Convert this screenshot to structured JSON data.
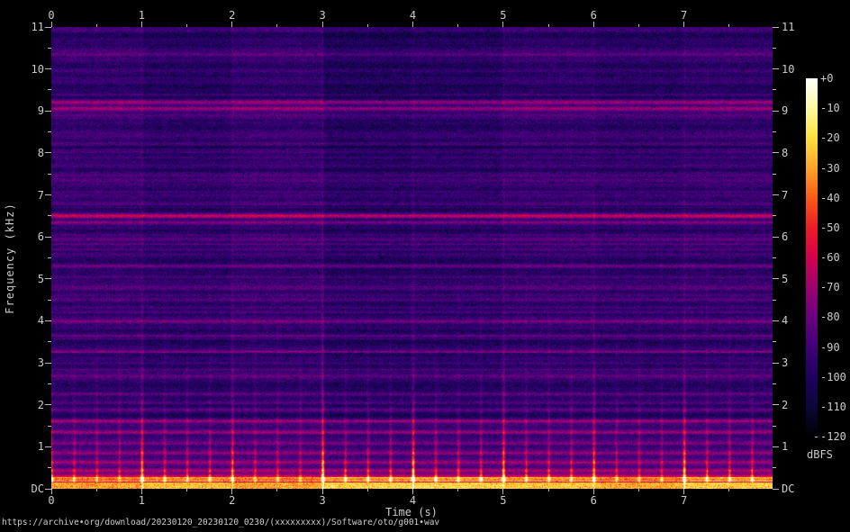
{
  "title": "https://archive•org/download/20230120_20230120_0230/(xxxxxxxxx)/Software/oto/g001•wav",
  "background_color": "#000000",
  "text_color": "#cccccc",
  "axes": {
    "x": {
      "label": "Time (s)",
      "ticks": [
        "0",
        "1",
        "2",
        "3",
        "4",
        "5",
        "6",
        "7"
      ],
      "minor_step_s": 0.5,
      "range_s": [
        0,
        7.98
      ]
    },
    "y": {
      "label": "Frequency (kHz)",
      "ticks": [
        "11",
        "10",
        "9",
        "8",
        "7",
        "6",
        "5",
        "4",
        "3",
        "2",
        "1",
        "DC"
      ],
      "minor_step_khz": 0.5,
      "range_khz": [
        0,
        11
      ]
    }
  },
  "colorbar": {
    "unit": "dBFS",
    "labels": [
      "+0",
      "-10",
      "-20",
      "-30",
      "-40",
      "-50",
      "-60",
      "-70",
      "-80",
      "-90",
      "-100",
      "-110",
      "-120"
    ],
    "stops": [
      "#ffffff",
      "#fffaa0",
      "#ffe03a",
      "#ffa32a",
      "#fb5a18",
      "#ee1c24",
      "#d4004e",
      "#9c0072",
      "#6a0080",
      "#400078",
      "#1e0060",
      "#0c0838",
      "#000000"
    ]
  },
  "chart_data": {
    "type": "heatmap",
    "subtype": "audio-spectrogram",
    "title": "https://archive•org/download/20230120_20230120_0230/(xxxxxxxxx)/Software/oto/g001•wav",
    "xlabel": "Time (s)",
    "ylabel": "Frequency (kHz)",
    "zlabel": "dBFS",
    "x_range_s": [
      0,
      7.98
    ],
    "y_range_khz": [
      0,
      11
    ],
    "z_range_dbfs": [
      -120,
      0
    ],
    "noise_floor_dbfs": -97,
    "segment_count": 8,
    "beat_interval_s": 0.25,
    "segment_boundary_strength_db": [
      13,
      12,
      16,
      13,
      12,
      13,
      12
    ],
    "segment_tint_db": [
      1.5,
      -2,
      1.5,
      -4.5,
      -3,
      0.5,
      -1.5,
      0.5
    ],
    "segment_bottom_boost_db": [
      1,
      4,
      1,
      7,
      7,
      5,
      2,
      6
    ],
    "beat_line_strength_db": 4.5,
    "bottom_band_top_khz": 0.17,
    "bottom_line_khz": 0.23,
    "low_freq_glow_top_khz": 2.3,
    "tonal_lines": [
      {
        "khz": 10.35,
        "db": 14,
        "w": 1.5
      },
      {
        "khz": 9.22,
        "db": 24,
        "w": 1.8
      },
      {
        "khz": 9.07,
        "db": 26,
        "w": 1.8
      },
      {
        "khz": 8.9,
        "db": 13,
        "w": 1.5
      },
      {
        "khz": 8.4,
        "db": 9,
        "w": 1.3
      },
      {
        "khz": 7.9,
        "db": 8,
        "w": 1.3
      },
      {
        "khz": 7.45,
        "db": 8,
        "w": 1.3
      },
      {
        "khz": 6.52,
        "db": 26,
        "w": 1.9
      },
      {
        "khz": 6.36,
        "db": 22,
        "w": 1.7
      },
      {
        "khz": 5.95,
        "db": 12,
        "w": 1.5
      },
      {
        "khz": 5.6,
        "db": 8,
        "w": 1.3
      },
      {
        "khz": 5.32,
        "db": 14,
        "w": 1.5
      },
      {
        "khz": 5.05,
        "db": 8,
        "w": 1.2
      },
      {
        "khz": 4.78,
        "db": 12,
        "w": 1.4
      },
      {
        "khz": 4.5,
        "db": 8,
        "w": 1.2
      },
      {
        "khz": 4.22,
        "db": 9,
        "w": 1.2
      },
      {
        "khz": 3.99,
        "db": 17,
        "w": 1.6
      },
      {
        "khz": 3.65,
        "db": 13,
        "w": 1.4
      },
      {
        "khz": 3.28,
        "db": 12,
        "w": 1.4
      },
      {
        "khz": 3.0,
        "db": 9,
        "w": 1.2
      },
      {
        "khz": 2.7,
        "db": 12,
        "w": 1.4
      },
      {
        "khz": 2.27,
        "db": 16,
        "w": 1.5
      },
      {
        "khz": 2.05,
        "db": 9,
        "w": 1.2
      },
      {
        "khz": 1.89,
        "db": 13,
        "w": 1.4
      },
      {
        "khz": 1.63,
        "db": 17,
        "w": 1.5
      },
      {
        "khz": 1.35,
        "db": 12,
        "w": 1.4
      },
      {
        "khz": 1.09,
        "db": 13,
        "w": 1.4
      },
      {
        "khz": 0.86,
        "db": 13,
        "w": 1.4
      },
      {
        "khz": 0.64,
        "db": 14,
        "w": 1.4
      },
      {
        "khz": 0.45,
        "db": 18,
        "w": 1.5
      },
      {
        "khz": 0.31,
        "db": 22,
        "w": 1.5
      }
    ]
  }
}
